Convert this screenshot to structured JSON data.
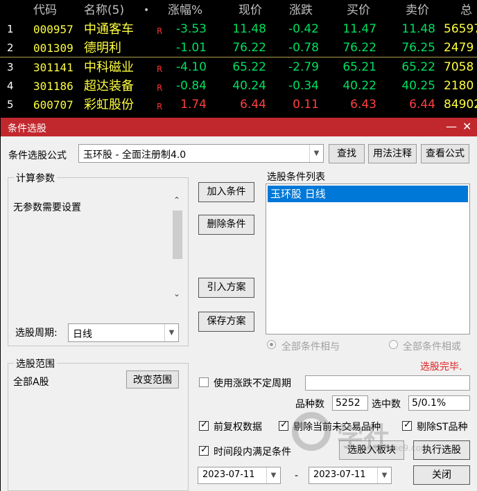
{
  "table": {
    "headers": {
      "code": "代码",
      "name": "名称(5)",
      "dot": "•",
      "chg_pct": "涨幅%",
      "price": "现价",
      "change": "涨跌",
      "bid": "买价",
      "ask": "卖价",
      "vol": "总"
    },
    "rows": [
      {
        "idx": "1",
        "code": "000957",
        "name": "中通客车",
        "flag": "R",
        "chg_pct": "-3.53",
        "price": "11.48",
        "change": "-0.42",
        "bid": "11.47",
        "ask": "11.48",
        "vol": "56597",
        "color": "#00e060"
      },
      {
        "idx": "2",
        "code": "001309",
        "name": "德明利",
        "flag": "",
        "chg_pct": "-1.01",
        "price": "76.22",
        "change": "-0.78",
        "bid": "76.22",
        "ask": "76.25",
        "vol": "2479",
        "color": "#00e060"
      },
      {
        "idx": "3",
        "code": "301141",
        "name": "中科磁业",
        "flag": "R",
        "chg_pct": "-4.10",
        "price": "65.22",
        "change": "-2.79",
        "bid": "65.21",
        "ask": "65.22",
        "vol": "7058",
        "color": "#00e060"
      },
      {
        "idx": "4",
        "code": "301186",
        "name": "超达装备",
        "flag": "R",
        "chg_pct": "-0.84",
        "price": "40.24",
        "change": "-0.34",
        "bid": "40.22",
        "ask": "40.25",
        "vol": "2180",
        "color": "#00e060"
      },
      {
        "idx": "5",
        "code": "600707",
        "name": "彩虹股份",
        "flag": "R",
        "chg_pct": "1.74",
        "price": "6.44",
        "change": "0.11",
        "bid": "6.43",
        "ask": "6.44",
        "vol": "84902",
        "color": "#ff4040"
      }
    ]
  },
  "dialog": {
    "title": "条件选股",
    "minimize": "—",
    "close": "✕",
    "formula_label": "条件选股公式",
    "formula_value": "玉环股  -  全面注册制4.0",
    "btn_find": "查找",
    "btn_usage": "用法注释",
    "btn_view": "查看公式",
    "params_group": "计算参数",
    "params_text": "无参数需要设置",
    "period_label": "选股周期:",
    "period_value": "日线",
    "btn_add": "加入条件",
    "btn_delete": "删除条件",
    "btn_import": "引入方案",
    "btn_save": "保存方案",
    "cond_list_label": "选股条件列表",
    "cond_items": [
      "玉环股  日线"
    ],
    "radio_and": "全部条件相与",
    "radio_or": "全部条件相或",
    "status": "选股完毕.",
    "scope_group": "选股范围",
    "scope_value": "全部A股",
    "btn_change_scope": "改变范围",
    "use_period_label": "使用涨跌不定周期",
    "count_label": "品种数",
    "count_value": "5252",
    "selected_label": "选中数",
    "selected_value": "5/0.1%",
    "chk_prerestore": "前复权数据",
    "chk_exclude_untraded": "剔除当前未交易品种",
    "chk_exclude_st": "剔除ST品种",
    "chk_time_range": "时间段内满足条件",
    "btn_to_block": "选股入板块",
    "btn_execute": "执行选股",
    "date_from": "2023-07-11",
    "date_sep": "-",
    "date_to": "2023-07-11",
    "btn_close": "关闭",
    "watermark_text": "学社",
    "watermark_url": "www.xueshe9.com"
  }
}
